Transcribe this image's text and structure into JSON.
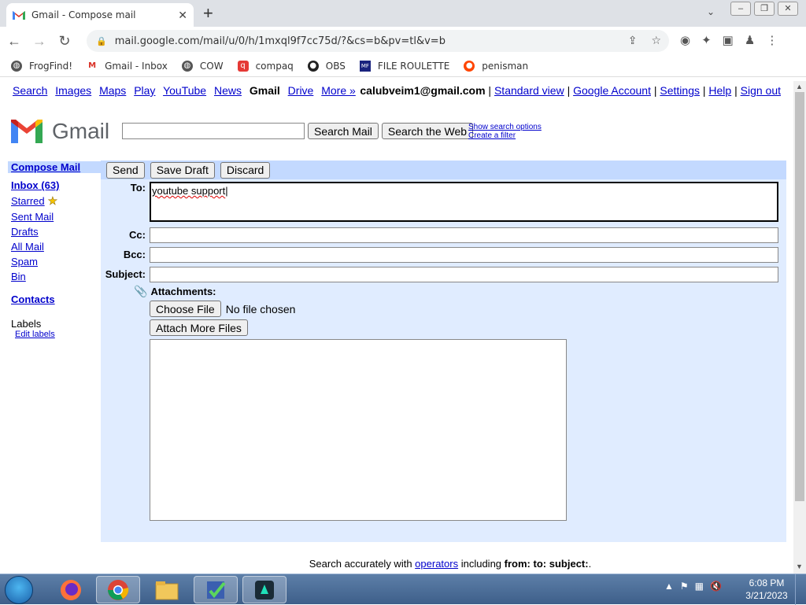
{
  "browser": {
    "tab_title": "Gmail - Compose mail",
    "tab_close": "✕",
    "new_tab": "+",
    "url": "mail.google.com/mail/u/0/h/1mxql9f7cc75d/?&cs=b&pv=tl&v=b",
    "bookmarks": [
      {
        "label": "FrogFind!",
        "icon": "globe-icon",
        "color": "#555555"
      },
      {
        "label": "Gmail - Inbox",
        "icon": "gmail-icon",
        "color": "#d93025"
      },
      {
        "label": "COW",
        "icon": "globe-icon",
        "color": "#555555"
      },
      {
        "label": "compaq",
        "icon": "compaq-icon",
        "color": "#e53935"
      },
      {
        "label": "OBS",
        "icon": "github-icon",
        "color": "#222222"
      },
      {
        "label": "FILE ROULETTE",
        "icon": "file-roulette-icon",
        "color": "#1a237e"
      },
      {
        "label": "penisman",
        "icon": "reddit-icon",
        "color": "#ff4500"
      }
    ]
  },
  "gmail": {
    "topnav": [
      "Search",
      "Images",
      "Maps",
      "Play",
      "YouTube",
      "News"
    ],
    "topnav_current": "Gmail",
    "topnav_after": [
      "Drive",
      "More »"
    ],
    "account_email": "calubveim1@gmail.com",
    "account_links": [
      "Standard view",
      "Google Account",
      "Settings",
      "Help",
      "Sign out"
    ],
    "logo_text": "Gmail",
    "search_mail_btn": "Search Mail",
    "search_web_btn": "Search the Web",
    "show_search_options": "Show search options",
    "create_filter": "Create a filter",
    "sidebar": {
      "compose": "Compose Mail",
      "inbox": "Inbox (63)",
      "starred": "Starred",
      "sent": "Sent Mail",
      "drafts": "Drafts",
      "all_mail": "All Mail",
      "spam": "Spam",
      "bin": "Bin",
      "contacts": "Contacts",
      "labels": "Labels",
      "edit_labels": "Edit labels"
    },
    "compose": {
      "send": "Send",
      "save_draft": "Save Draft",
      "discard": "Discard",
      "to_label": "To:",
      "to_value": "youtube support",
      "cc_label": "Cc:",
      "bcc_label": "Bcc:",
      "subject_label": "Subject:",
      "attachments_label": "Attachments:",
      "choose_file": "Choose File",
      "no_file": "No file chosen",
      "attach_more": "Attach More Files"
    },
    "footer": {
      "prefix": "Search accurately with",
      "link": "operators",
      "middle": "including",
      "from": "from:",
      "to": "to:",
      "subject": "subject:",
      "end": "."
    }
  },
  "taskbar": {
    "time": "6:08 PM",
    "date": "3/21/2023",
    "apps": [
      "firefox-icon",
      "chrome-icon",
      "file-explorer-icon",
      "task-checklist-icon",
      "filmora-icon"
    ]
  }
}
